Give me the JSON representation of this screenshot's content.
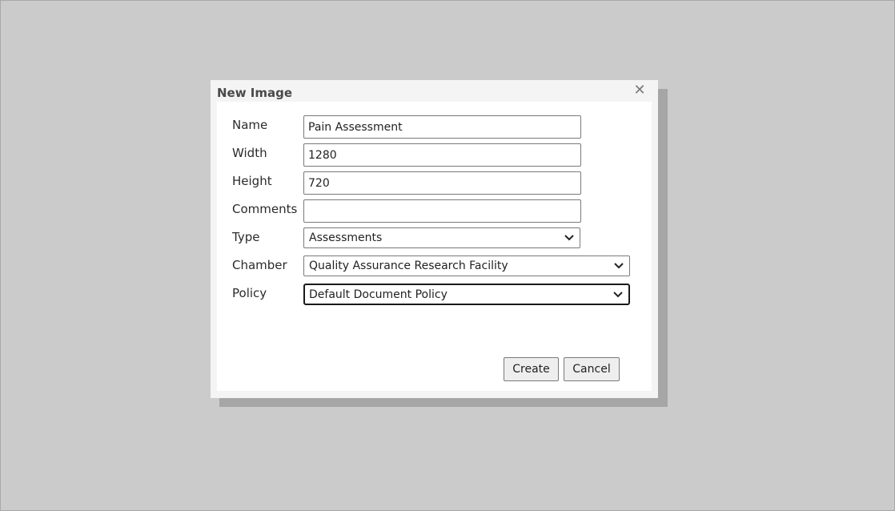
{
  "dialog": {
    "title": "New Image",
    "close_icon": "close-icon"
  },
  "fields": {
    "name": {
      "label": "Name",
      "value": "Pain Assessment"
    },
    "width": {
      "label": "Width",
      "value": "1280"
    },
    "height": {
      "label": "Height",
      "value": "720"
    },
    "comments": {
      "label": "Comments",
      "value": ""
    },
    "type": {
      "label": "Type",
      "value": "Assessments"
    },
    "chamber": {
      "label": "Chamber",
      "value": "Quality Assurance Research Facility"
    },
    "policy": {
      "label": "Policy",
      "value": "Default Document Policy"
    }
  },
  "buttons": {
    "create": "Create",
    "cancel": "Cancel"
  },
  "colors": {
    "backdrop": "#cbcbcb",
    "dialog_header": "#f4f4f4",
    "dialog_body": "#ffffff",
    "button_bg": "#eeeeee"
  }
}
